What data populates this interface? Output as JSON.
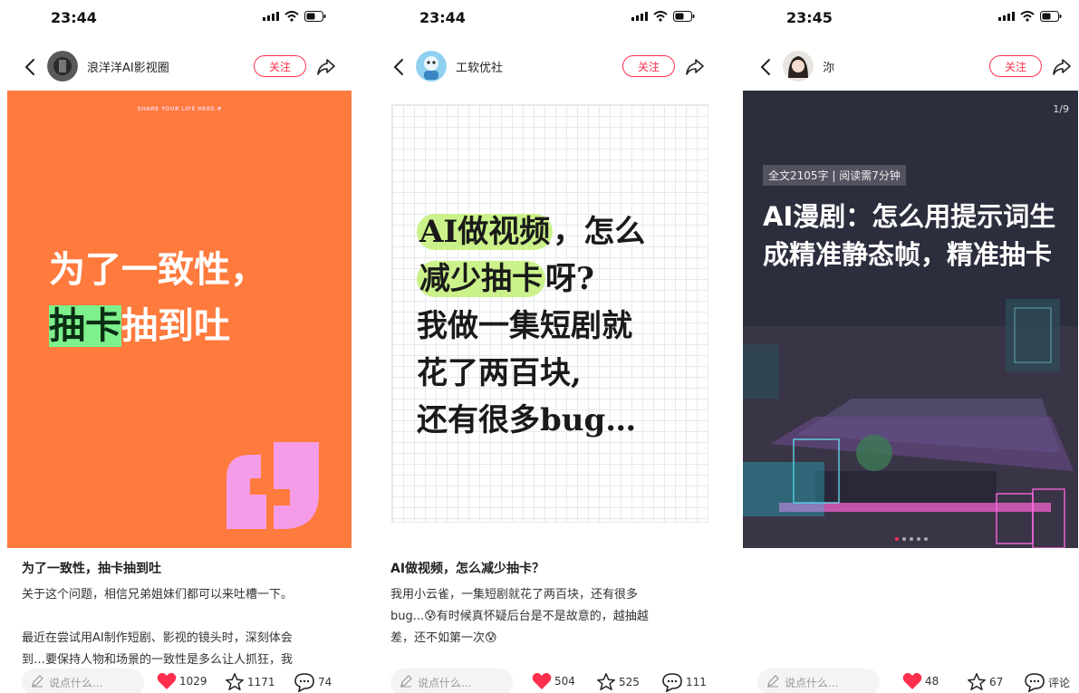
{
  "status": {
    "times": [
      "23:44",
      "23:44",
      "23:45"
    ]
  },
  "follow_label": "关注",
  "comment_placeholder": "说点什么...",
  "posts": [
    {
      "author": "浪洋洋AI影视圈",
      "cover": {
        "tag": "SHARE YOUR LIFE HERE.▼",
        "line1": "为了一致性，",
        "line2_highlight": "抽卡",
        "line2_rest": "抽到吐"
      },
      "title": "为了一致性，抽卡抽到吐",
      "body": [
        "关于这个问题，相信兄弟姐妹们都可以来吐槽一下。",
        "",
        "最近在尝试用AI制作短剧、影视的镜头时，深刻体会",
        "到…要保持人物和场景的一致性是多么让人抓狂，我"
      ],
      "likes": "1029",
      "stars": "1171",
      "comments": "74"
    },
    {
      "author": "工软优社",
      "cover": {
        "l1a": "AI做视频",
        "l1b": "，怎么",
        "l2a": "减少抽卡",
        "l2b": "呀?",
        "l3": "我做一集短剧就",
        "l4": "花了两百块,",
        "l5": "还有很多bug…"
      },
      "title": "AI做视频，怎么减少抽卡？",
      "body": [
        "我用小云雀，一集短剧就花了两百块，还有很多",
        "bug...😰有时候真怀疑后台是不是故意的，越抽越",
        "差，还不如第一次😰"
      ],
      "likes": "504",
      "stars": "525",
      "comments": "111"
    },
    {
      "author": "沵",
      "cover": {
        "pager": "1/9",
        "chip": "全文2105字 | 阅读需7分钟",
        "title": "AI漫剧：怎么用提示词生成精准静态帧，精准抽卡"
      },
      "likes": "48",
      "stars": "67",
      "comments": "评论"
    }
  ],
  "colors": {
    "accent": "#ff2e4d",
    "cover1": "#ff7a3d",
    "highlight1": "#7ef08c",
    "highlight2": "#cbf28a",
    "quote": "#f59ce8"
  },
  "icons": [
    "back-arrow-icon",
    "share-icon",
    "heart-icon",
    "star-icon",
    "comment-icon",
    "pencil-icon",
    "signal-icon",
    "wifi-icon",
    "battery-icon"
  ]
}
